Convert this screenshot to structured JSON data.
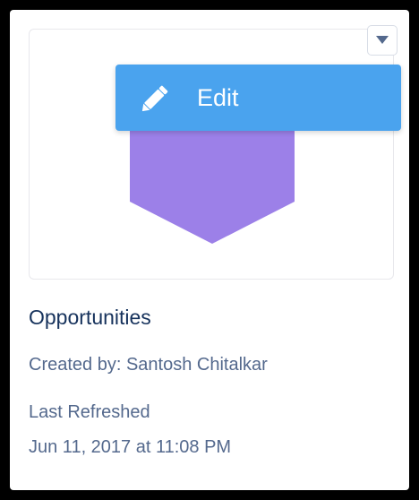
{
  "card": {
    "title": "Opportunities",
    "created_by": "Created by: Santosh Chitalkar",
    "last_refreshed_label": "Last Refreshed",
    "last_refreshed_value": "Jun 11, 2017 at 11:08 PM"
  },
  "menu": {
    "edit_label": "Edit",
    "icon": "pencil-icon",
    "background": "#4aa3ee"
  },
  "dropdown": {
    "icon": "chevron-down-icon"
  },
  "chart_data": {
    "type": "funnel",
    "stages": [
      {
        "color": "#9c80e8"
      }
    ]
  }
}
